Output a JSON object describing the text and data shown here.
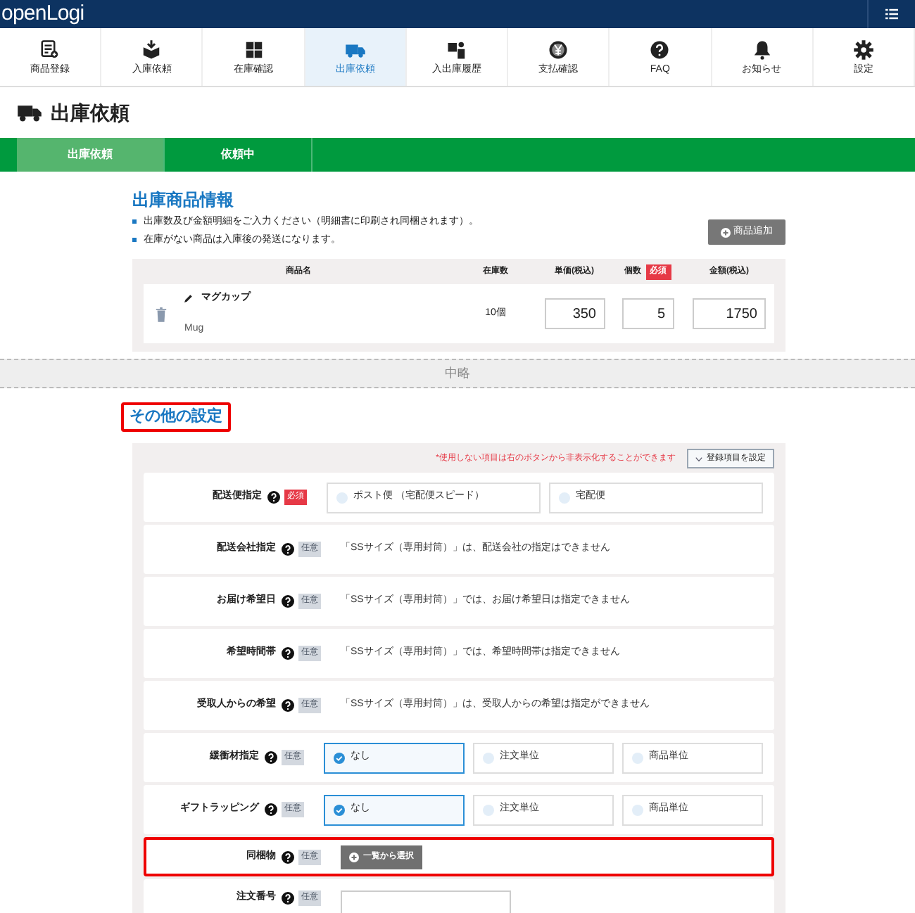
{
  "header": {
    "logo": "openLogi"
  },
  "nav": [
    {
      "label": "商品登録",
      "selected": false
    },
    {
      "label": "入庫依頼",
      "selected": false
    },
    {
      "label": "在庫確認",
      "selected": false
    },
    {
      "label": "出庫依頼",
      "selected": true
    },
    {
      "label": "入出庫履歴",
      "selected": false
    },
    {
      "label": "支払確認",
      "selected": false
    },
    {
      "label": "FAQ",
      "selected": false
    },
    {
      "label": "お知らせ",
      "selected": false
    },
    {
      "label": "設定",
      "selected": false
    }
  ],
  "page_title": "出庫依頼",
  "steps": [
    {
      "label": "出庫依頼",
      "selected": true
    },
    {
      "label": "依頼中",
      "selected": false
    }
  ],
  "product_section": {
    "title": "出庫商品情報",
    "notes": [
      "出庫数及び金額明細をご入力ください（明細書に印刷され同梱されます）。",
      "在庫がない商品は入庫後の発送になります。"
    ],
    "add_button": "商品追加",
    "columns": [
      {
        "label": "商品名"
      },
      {
        "label": "在庫数"
      },
      {
        "label": "単価(税込)"
      },
      {
        "label": "個数",
        "badge": "必須"
      },
      {
        "label": "金額(税込)"
      }
    ],
    "rows": [
      {
        "name": "マグカップ",
        "subname": "Mug",
        "stock": "10個",
        "price": "350",
        "quantity": "5",
        "amount": "1750"
      }
    ]
  },
  "omitted": "中略",
  "other_settings": {
    "title": "その他の設定",
    "highlighted": true,
    "hint": "*使用しない項目は右のボタンから非表示化することができます",
    "settings_button": "登録項目を設定",
    "rows": [
      {
        "label": "配送便指定",
        "badge": {
          "text": "必須",
          "kind": "required"
        },
        "kind": "options",
        "highlighted": false,
        "options": [
          {
            "label": "ポスト便 （宅配便スピード）",
            "selected": false
          },
          {
            "label": "宅配便",
            "selected": false
          }
        ]
      },
      {
        "label": "配送会社指定",
        "badge": {
          "text": "任意",
          "kind": "optional"
        },
        "kind": "text",
        "highlighted": false,
        "text": "「SSサイズ（専用封筒）」は、配送会社の指定はできません"
      },
      {
        "label": "お届け希望日",
        "badge": {
          "text": "任意",
          "kind": "optional"
        },
        "kind": "text",
        "highlighted": false,
        "text": "「SSサイズ（専用封筒）」では、お届け希望日は指定できません"
      },
      {
        "label": "希望時間帯",
        "badge": {
          "text": "任意",
          "kind": "optional"
        },
        "kind": "text",
        "highlighted": false,
        "text": "「SSサイズ（専用封筒）」では、希望時間帯は指定できません"
      },
      {
        "label": "受取人からの希望",
        "badge": {
          "text": "任意",
          "kind": "optional"
        },
        "kind": "text",
        "highlighted": false,
        "text": "「SSサイズ（専用封筒）」は、受取人からの希望は指定ができません"
      },
      {
        "label": "緩衝材指定",
        "badge": {
          "text": "任意",
          "kind": "optional"
        },
        "kind": "options",
        "highlighted": false,
        "options": [
          {
            "label": "なし",
            "selected": true
          },
          {
            "label": "注文単位",
            "selected": false
          },
          {
            "label": "商品単位",
            "selected": false
          }
        ]
      },
      {
        "label": "ギフトラッピング",
        "badge": {
          "text": "任意",
          "kind": "optional"
        },
        "kind": "options",
        "highlighted": false,
        "options": [
          {
            "label": "なし",
            "selected": true
          },
          {
            "label": "注文単位",
            "selected": false
          },
          {
            "label": "商品単位",
            "selected": false
          }
        ]
      },
      {
        "label": "同梱物",
        "badge": {
          "text": "任意",
          "kind": "optional"
        },
        "kind": "button",
        "highlighted": true,
        "button": "一覧から選択"
      },
      {
        "label": "注文番号",
        "badge": {
          "text": "任意",
          "kind": "optional"
        },
        "kind": "input",
        "highlighted": false
      }
    ]
  }
}
